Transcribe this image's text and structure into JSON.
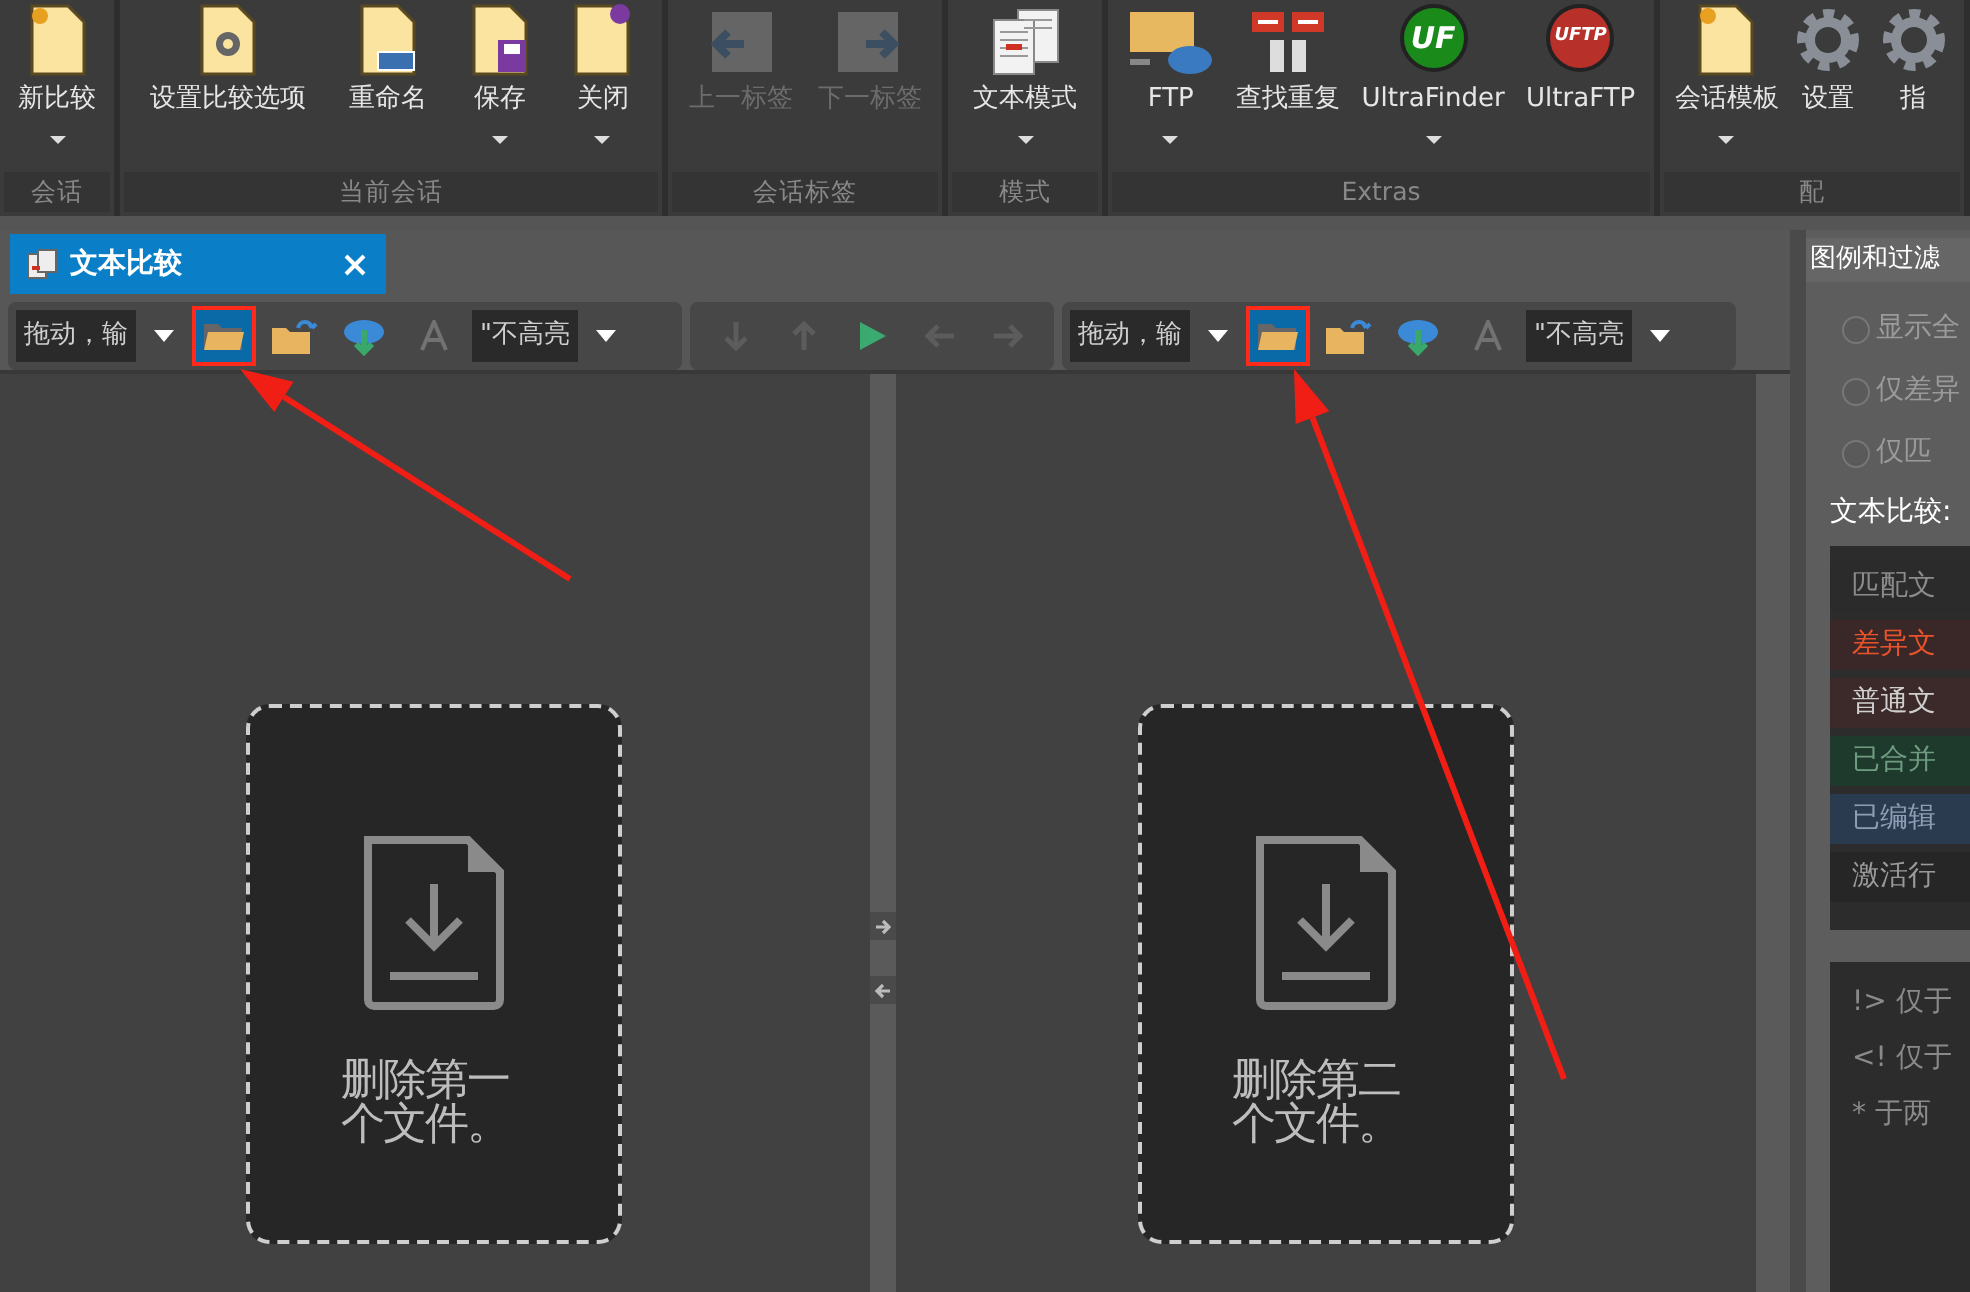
{
  "ribbon": {
    "groups": [
      {
        "label": "会话",
        "buttons": [
          {
            "label": "新比较",
            "kind": "newdoc",
            "dropdown": true,
            "disabled": false
          }
        ]
      },
      {
        "label": "当前会话",
        "buttons": [
          {
            "label": "设置比较选项",
            "kind": "settingsdoc",
            "dropdown": false,
            "disabled": false
          },
          {
            "label": "重命名",
            "kind": "renamedoc",
            "dropdown": false,
            "disabled": false
          },
          {
            "label": "保存",
            "kind": "savedoc",
            "dropdown": true,
            "disabled": false
          },
          {
            "label": "关闭",
            "kind": "closedoc",
            "dropdown": true,
            "disabled": false
          }
        ]
      },
      {
        "label": "会话标签",
        "buttons": [
          {
            "label": "上一标签",
            "kind": "prevtab",
            "dropdown": false,
            "disabled": true
          },
          {
            "label": "下一标签",
            "kind": "nexttab",
            "dropdown": false,
            "disabled": true
          }
        ]
      },
      {
        "label": "模式",
        "buttons": [
          {
            "label": "文本模式",
            "kind": "textmode",
            "dropdown": true,
            "disabled": false
          }
        ]
      },
      {
        "label": "Extras",
        "buttons": [
          {
            "label": "FTP",
            "kind": "ftp",
            "dropdown": true,
            "disabled": false
          },
          {
            "label": "查找重复",
            "kind": "finddup",
            "dropdown": false,
            "disabled": false
          },
          {
            "label": "UltraFinder",
            "kind": "logo",
            "logo_text": "UF",
            "color": "#1a8a1a",
            "dropdown": true,
            "disabled": false
          },
          {
            "label": "UltraFTP",
            "kind": "logo",
            "logo_text": "UFTP",
            "color": "#b8302a",
            "dropdown": false,
            "disabled": false
          }
        ]
      },
      {
        "label": "配",
        "buttons": [
          {
            "label": "会话模板",
            "kind": "newdoc",
            "dropdown": true,
            "disabled": false
          },
          {
            "label": "设置",
            "kind": "gear",
            "dropdown": false,
            "disabled": false
          },
          {
            "label": "指",
            "kind": "gear",
            "dropdown": false,
            "disabled": false
          }
        ]
      }
    ]
  },
  "document_tab": {
    "title": "文本比较",
    "selected": true
  },
  "left_pane": {
    "toolbar": [
      {
        "kind": "combo",
        "value": "拖动，输"
      },
      {
        "kind": "open",
        "highlighted": true,
        "disabled": false
      },
      {
        "kind": "reopen",
        "highlighted": false,
        "disabled": false
      },
      {
        "kind": "cloud",
        "highlighted": false,
        "disabled": false
      },
      {
        "kind": "font",
        "highlighted": false,
        "disabled": true
      },
      {
        "kind": "combo",
        "value": "\"不高亮"
      }
    ],
    "drop_text": "删除第一个文件。"
  },
  "nav_toolbar": [
    {
      "kind": "down",
      "disabled": true
    },
    {
      "kind": "up",
      "disabled": true
    },
    {
      "kind": "play",
      "disabled": false
    },
    {
      "kind": "left",
      "disabled": true
    },
    {
      "kind": "right",
      "disabled": true
    }
  ],
  "right_pane": {
    "toolbar": [
      {
        "kind": "combo",
        "value": "拖动，输"
      },
      {
        "kind": "open",
        "highlighted": true,
        "disabled": false
      },
      {
        "kind": "reopen",
        "highlighted": false,
        "disabled": false
      },
      {
        "kind": "cloud",
        "highlighted": false,
        "disabled": false
      },
      {
        "kind": "font",
        "highlighted": false,
        "disabled": true
      },
      {
        "kind": "combo",
        "value": "\"不高亮"
      }
    ],
    "drop_text": "删除第二个文件。"
  },
  "side_panel": {
    "title": "图例和过滤",
    "filters": [
      {
        "label": "显示全",
        "selected": false
      },
      {
        "label": "仅差异",
        "selected": false
      },
      {
        "label": "仅匹",
        "selected": false
      }
    ],
    "legend_label": "文本比较:",
    "legend": [
      {
        "label": "匹配文",
        "kind": "match",
        "color": "#2b2b2b"
      },
      {
        "label": "差异文",
        "kind": "diff",
        "color": "#3a2727"
      },
      {
        "label": "普通文",
        "kind": "normal",
        "color": "#3b2a29"
      },
      {
        "label": "已合并",
        "kind": "merged",
        "color": "#1d3a2c"
      },
      {
        "label": "已编辑",
        "kind": "edited",
        "color": "#2a3b50"
      },
      {
        "label": "激活行",
        "kind": "active",
        "color": "#262626"
      }
    ],
    "notes": [
      "!> 仅于",
      "<! 仅于",
      "* 于两"
    ]
  }
}
